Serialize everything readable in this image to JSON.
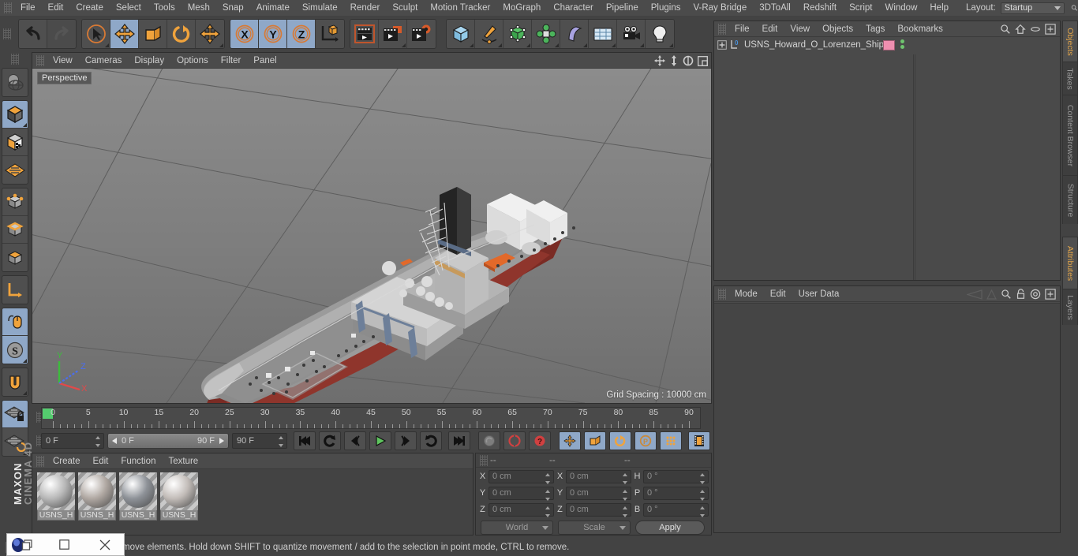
{
  "app": {
    "brand": "MAXON",
    "product": "CINEMA 4D"
  },
  "topmenu": {
    "items": [
      "File",
      "Edit",
      "Create",
      "Select",
      "Tools",
      "Mesh",
      "Snap",
      "Animate",
      "Simulate",
      "Render",
      "Sculpt",
      "Motion Tracker",
      "MoGraph",
      "Character",
      "Pipeline",
      "Plugins",
      "V-Ray Bridge",
      "3DToAll",
      "Redshift",
      "Script",
      "Window",
      "Help"
    ],
    "layout_label": "Layout:",
    "layout_value": "Startup",
    "search_icon": "search-icon"
  },
  "toolbar": {
    "groups": [
      {
        "name": "history",
        "buttons": [
          {
            "name": "undo-button",
            "icon": "undo-arrow-icon",
            "selected": false,
            "disabled": false
          },
          {
            "name": "redo-button",
            "icon": "redo-arrow-icon",
            "selected": false,
            "disabled": true
          }
        ]
      },
      {
        "name": "transform-tools",
        "buttons": [
          {
            "name": "live-selection-tool",
            "icon": "cursor-circle-icon",
            "selected": false,
            "disabled": false
          },
          {
            "name": "move-tool",
            "icon": "move-arrows-icon",
            "selected": true,
            "disabled": false
          },
          {
            "name": "scale-tool",
            "icon": "scale-box-icon",
            "selected": false,
            "disabled": false
          },
          {
            "name": "rotate-tool",
            "icon": "rotate-arc-icon",
            "selected": false,
            "disabled": false
          },
          {
            "name": "transform-tool",
            "icon": "move-arrows-icon",
            "selected": false,
            "disabled": false
          }
        ]
      },
      {
        "name": "axis-locks",
        "buttons": [
          {
            "name": "lock-x-axis-button",
            "icon": "x-axis-icon",
            "label": "X",
            "selected": true
          },
          {
            "name": "lock-y-axis-button",
            "icon": "y-axis-icon",
            "label": "Y",
            "selected": true
          },
          {
            "name": "lock-z-axis-button",
            "icon": "z-axis-icon",
            "label": "Z",
            "selected": true
          },
          {
            "name": "world-object-coordinate-button",
            "icon": "axis-cube-icon",
            "selected": false
          }
        ]
      },
      {
        "name": "render-tools",
        "buttons": [
          {
            "name": "render-view-button",
            "icon": "render-clapper-icon",
            "selected": false
          },
          {
            "name": "render-to-picture-viewer-button",
            "icon": "render-picture-icon",
            "selected": false
          },
          {
            "name": "render-settings-button",
            "icon": "render-settings-gear-icon",
            "selected": false
          }
        ]
      },
      {
        "name": "object-creation",
        "buttons": [
          {
            "name": "add-cube-button",
            "icon": "cube-icon",
            "selected": false
          },
          {
            "name": "add-spline-button",
            "icon": "pen-spline-icon",
            "selected": false
          },
          {
            "name": "add-generator-button",
            "icon": "generator-cube-icon",
            "selected": false
          },
          {
            "name": "add-array-button",
            "icon": "array-green-icon",
            "selected": false
          },
          {
            "name": "add-deformer-button",
            "icon": "bend-deformer-icon",
            "selected": false
          },
          {
            "name": "add-environment-button",
            "icon": "floor-grid-icon",
            "selected": false
          },
          {
            "name": "add-camera-button",
            "icon": "camera-icon",
            "selected": false
          },
          {
            "name": "add-light-button",
            "icon": "light-bulb-icon",
            "selected": false
          }
        ]
      }
    ]
  },
  "lefttoolbar": {
    "groups": [
      {
        "buttons": [
          {
            "name": "make-editable-button",
            "icon": "globe-mesh-icon",
            "selected": false
          }
        ]
      },
      {
        "buttons": [
          {
            "name": "model-mode-button",
            "icon": "model-cube-icon",
            "selected": true
          },
          {
            "name": "texture-mode-button",
            "icon": "texture-cube-icon",
            "selected": false
          },
          {
            "name": "workplane-mode-button",
            "icon": "workplane-grid-icon",
            "selected": false
          }
        ]
      },
      {
        "buttons": [
          {
            "name": "points-mode-button",
            "icon": "points-cube-icon",
            "selected": false
          },
          {
            "name": "edges-mode-button",
            "icon": "edges-cube-icon",
            "selected": false
          },
          {
            "name": "polygons-mode-button",
            "icon": "polygons-cube-icon",
            "selected": false
          }
        ]
      },
      {
        "buttons": [
          {
            "name": "world-axis-button",
            "icon": "axis-corner-icon",
            "selected": false
          }
        ]
      },
      {
        "buttons": [
          {
            "name": "viewport-solo-button",
            "icon": "mouse-icon",
            "selected": true
          },
          {
            "name": "enable-snap-button",
            "icon": "snap-s-icon",
            "selected": true
          }
        ]
      },
      {
        "buttons": [
          {
            "name": "magnet-tool-button",
            "icon": "magnet-icon",
            "selected": false
          }
        ]
      },
      {
        "buttons": [
          {
            "name": "lock-workplane-button",
            "icon": "workplane-lock-icon",
            "selected": true
          },
          {
            "name": "planar-workplane-button",
            "icon": "workplane-rotate-icon",
            "selected": false
          }
        ]
      }
    ]
  },
  "viewport": {
    "menu": [
      "View",
      "Cameras",
      "Display",
      "Options",
      "Filter",
      "Panel"
    ],
    "corner_icons": [
      "pan-icon",
      "dolly-icon",
      "rotate-icon",
      "maximize-icon"
    ],
    "perspective_label": "Perspective",
    "grid_spacing": "Grid Spacing : 10000 cm",
    "axis_labels": {
      "x": "X",
      "y": "Y",
      "z": "Z"
    },
    "axis_colors": {
      "x": "#e04a4a",
      "y": "#3dbb3d",
      "z": "#4a6ef0"
    },
    "bg_color": "#7c7c7c"
  },
  "timeline": {
    "ruler_labels": [
      "0",
      "5",
      "10",
      "15",
      "20",
      "25",
      "30",
      "35",
      "40",
      "45",
      "50",
      "55",
      "60",
      "65",
      "70",
      "75",
      "80",
      "85",
      "90"
    ],
    "start_frame": "0 F",
    "current_frame_field": "0 F",
    "range_start": "0 F",
    "range_end": "90 F",
    "end_frame": "90 F",
    "preview_min": "0 F",
    "buttons": [
      {
        "name": "goto-start-button",
        "icon": "skip-start-icon",
        "selected": false
      },
      {
        "name": "play-backwards-button",
        "icon": "rewind-loop-icon",
        "selected": false
      },
      {
        "name": "previous-frame-button",
        "icon": "step-back-icon",
        "selected": false
      },
      {
        "name": "play-button",
        "icon": "play-icon",
        "selected": false
      },
      {
        "name": "next-frame-button",
        "icon": "step-forward-icon",
        "selected": false
      },
      {
        "name": "play-forward-loop-button",
        "icon": "forward-loop-icon",
        "selected": false
      },
      {
        "name": "goto-end-button",
        "icon": "skip-end-icon",
        "selected": false
      },
      {
        "name": "record-active-objects-button",
        "icon": "key-record-icon",
        "selected": false
      },
      {
        "name": "autokeying-button",
        "icon": "autokey-red-icon",
        "selected": false
      },
      {
        "name": "keyframe-selection-button",
        "icon": "question-red-icon",
        "selected": false
      },
      {
        "name": "position-key-button",
        "icon": "position-move-icon",
        "selected": true
      },
      {
        "name": "scale-key-button",
        "icon": "scale-key-icon",
        "selected": true
      },
      {
        "name": "rotation-key-button",
        "icon": "rotate-key-icon",
        "selected": true
      },
      {
        "name": "param-key-button",
        "icon": "param-p-icon",
        "selected": true
      },
      {
        "name": "point-level-animation-button",
        "icon": "pla-dots-icon",
        "selected": true
      },
      {
        "name": "timeline-toggle-button",
        "icon": "filmstrip-icon",
        "selected": true
      }
    ]
  },
  "material_manager": {
    "menu": [
      "Create",
      "Edit",
      "Function",
      "Texture"
    ],
    "materials": [
      {
        "name": "USNS_H",
        "color": "#b8b8b8",
        "selected": true
      },
      {
        "name": "USNS_H",
        "color": "#b0a8a2",
        "selected": true
      },
      {
        "name": "USNS_H",
        "color": "#8e9298",
        "selected": true
      },
      {
        "name": "USNS_H",
        "color": "#c2bcb8",
        "selected": true
      }
    ]
  },
  "coordinates": {
    "headers": [
      "--",
      "--",
      "--"
    ],
    "rows": [
      {
        "label1": "X",
        "value1": "0 cm",
        "label2": "X",
        "value2": "0 cm",
        "label3": "H",
        "value3": "0 °"
      },
      {
        "label1": "Y",
        "value1": "0 cm",
        "label2": "Y",
        "value2": "0 cm",
        "label3": "P",
        "value3": "0 °"
      },
      {
        "label1": "Z",
        "value1": "0 cm",
        "label2": "Z",
        "value2": "0 cm",
        "label3": "B",
        "value3": "0 °"
      }
    ],
    "system": "World",
    "mode": "Scale",
    "apply": "Apply"
  },
  "object_manager": {
    "menu": [
      "File",
      "Edit",
      "View",
      "Objects",
      "Tags",
      "Bookmarks"
    ],
    "icons": [
      "search-icon",
      "home-icon",
      "ellipse-icon",
      "expand-icon"
    ],
    "object": {
      "name": "USNS_Howard_O_Lorenzen_Ship",
      "layer_badge": "0",
      "tag_color": "#ef8fb0"
    }
  },
  "attribute_manager": {
    "menu": [
      "Mode",
      "Edit",
      "User Data"
    ],
    "icons": [
      "back-arrow-icon",
      "forward-arrow-icon",
      "search-icon",
      "lock-icon",
      "target-icon",
      "expand-icon"
    ]
  },
  "right_tabs": {
    "top": [
      {
        "label": "Objects",
        "active": true
      },
      {
        "label": "Takes",
        "active": false
      },
      {
        "label": "Content Browser",
        "active": false
      },
      {
        "label": "Structure",
        "active": false
      }
    ],
    "bottom": [
      {
        "label": "Attributes",
        "active": true
      },
      {
        "label": "Layers",
        "active": false
      }
    ]
  },
  "statusbar": {
    "text": "move elements. Hold down SHIFT to quantize movement / add to the selection in point mode, CTRL to remove."
  },
  "float_window": {
    "buttons": [
      "restore-icon",
      "maximize-icon",
      "close-icon"
    ],
    "close_glyph": "✕",
    "max_glyph": "□"
  },
  "colors": {
    "panel_bg": "#434343",
    "menu_bg": "#4b4b4b",
    "accent_orange": "#e0a44a",
    "selected_blue": "#8fa8c8",
    "viewport_gray": "#7c7c7c"
  }
}
